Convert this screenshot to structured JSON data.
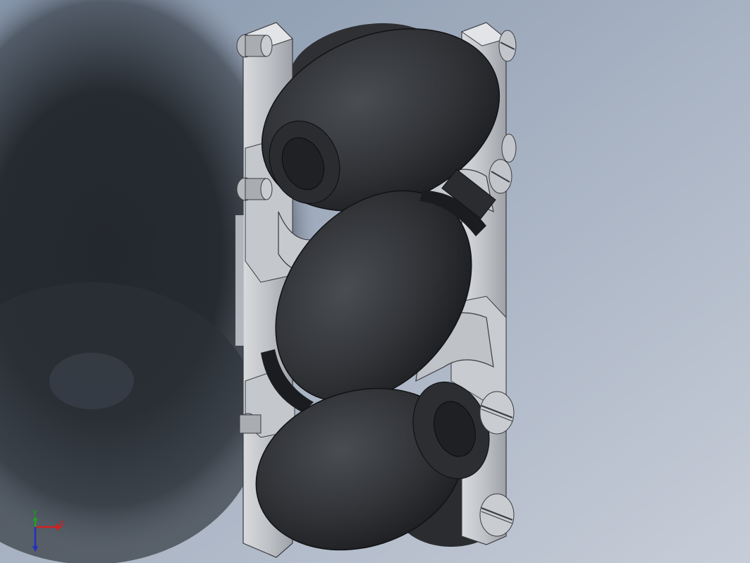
{
  "viewport": {
    "background": {
      "top_color": "#8f9db3",
      "bottom_color": "#c3cad6"
    },
    "model": {
      "name": "mecanum-wheel",
      "roller_color": "#2f3134",
      "bracket_color": "#c9ccd1",
      "shadow_color": "#23272c"
    },
    "triad": {
      "x_label": "X",
      "y_label": "Y",
      "x_color": "#d22020",
      "y_color": "#20a020",
      "z_color": "#2030c0"
    }
  }
}
